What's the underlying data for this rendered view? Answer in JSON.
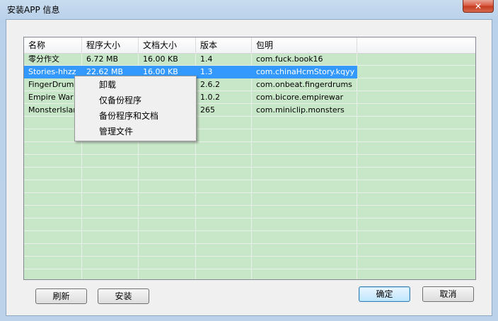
{
  "window": {
    "title": "安装APP 信息",
    "close_glyph": "✕"
  },
  "listview": {
    "columns": [
      "名称",
      "程序大小",
      "文档大小",
      "版本",
      "包明"
    ],
    "rows": [
      [
        "零分作文",
        "6.72 MB",
        "16.00 KB",
        "1.4",
        "com.fuck.book16"
      ],
      [
        "Stories-hhzz",
        "22.62 MB",
        "16.00 KB",
        "1.3",
        "com.chinaHcmStory.kqyy"
      ],
      [
        "FingerDrums",
        "",
        "",
        "2.6.2",
        "com.onbeat.fingerdrums"
      ],
      [
        "Empire War",
        "",
        "",
        "1.0.2",
        "com.bicore.empirewar"
      ],
      [
        "MonsterIsland",
        "",
        "",
        "265",
        "com.miniclip.monsters"
      ]
    ],
    "selected_row": 1
  },
  "context_menu": {
    "items": [
      "卸载",
      "仅备份程序",
      "备份程序和文档",
      "管理文件"
    ]
  },
  "buttons": {
    "refresh": "刷新",
    "install": "安装",
    "ok": "确定",
    "cancel": "取消"
  }
}
